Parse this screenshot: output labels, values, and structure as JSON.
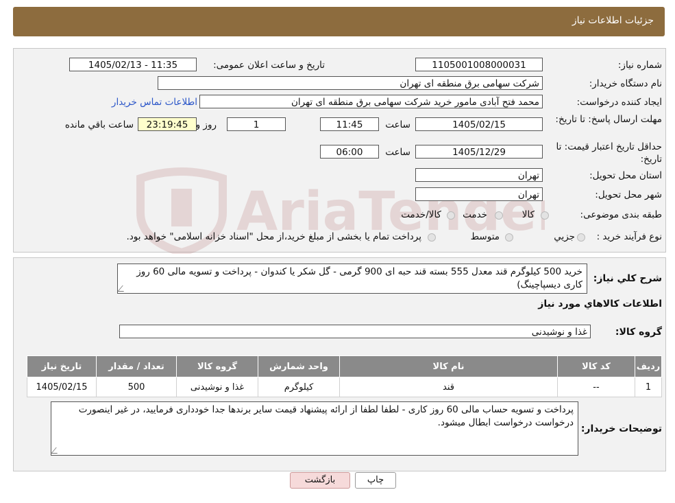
{
  "header": {
    "title": "جزئیات اطلاعات نیاز"
  },
  "form": {
    "need_number_label": "شماره نیاز:",
    "need_number": "1105001008000031",
    "announce_label": "تاریخ و ساعت اعلان عمومی:",
    "announce_value": "1405/02/13 - 11:35",
    "buyer_org_label": "نام دستگاه خریدار:",
    "buyer_org": "شرکت سهامی برق منطقه ای تهران",
    "creator_label": "ایجاد کننده درخواست:",
    "creator": "محمد فتح آبادی مامور خرید شرکت سهامی برق منطقه ای تهران",
    "contact_link": "اطلاعات تماس خریدار",
    "reply_deadline_label": "مهلت ارسال پاسخ: تا تاریخ:",
    "reply_date": "1405/02/15",
    "time_label": "ساعت",
    "reply_time": "11:45",
    "days_value": "1",
    "days_label": "روز و",
    "remaining_time": "23:19:45",
    "remaining_label": "ساعت باقي مانده",
    "validity_label": "حداقل تاریخ اعتبار قیمت: تا تاریخ:",
    "validity_date": "1405/12/29",
    "validity_time": "06:00",
    "province_label": "استان محل تحویل:",
    "province": "تهران",
    "city_label": "شهر محل تحویل:",
    "city": "تهران",
    "category_label": "طبقه بندی موضوعی:",
    "category_options": [
      "کالا",
      "خدمت",
      "کالا/خدمت"
    ],
    "process_label": "نوع فرآیند خرید :",
    "process_options": [
      "جزيي",
      "متوسط"
    ],
    "process_note": "پرداخت تمام یا بخشی از مبلغ خرید،از محل \"اسناد خزانه اسلامی\" خواهد بود."
  },
  "watermark": {
    "text": "AriaTender.neT"
  },
  "details": {
    "summary_label": "شرح كلي نياز:",
    "summary": "خرید 500 کیلوگرم قند معدل 555 بسته قند حبه ای 900 گرمی - گل شکر یا کندوان - پرداخت و تسویه مالی 60 روز کاری دیسپاچینگ)",
    "goods_info_title": "اطلاعات كالاهاي مورد نياز",
    "goods_group_label": "گروه كالا:",
    "goods_group": "غذا و نوشیدنی",
    "table": {
      "headers": [
        "رديف",
        "كد كالا",
        "نام كالا",
        "واحد شمارش",
        "گروه كالا",
        "تعداد / مقدار",
        "تاريخ نياز"
      ],
      "rows": [
        [
          "1",
          "--",
          "قند",
          "کیلوگرم",
          "غذا و نوشیدنی",
          "500",
          "1405/02/15"
        ]
      ]
    },
    "buyer_notes_label": "توضیحات خریدار:",
    "buyer_notes": "پرداخت و تسویه حساب مالی 60 روز کاری - لطفا لطفا از ارائه پیشنهاد قیمت سایر برندها جدا خودداری فرمایید، در غیر اینصورت درخواست درخواست ابطال میشود."
  },
  "buttons": {
    "print": "چاپ",
    "back": "بازگشت"
  }
}
